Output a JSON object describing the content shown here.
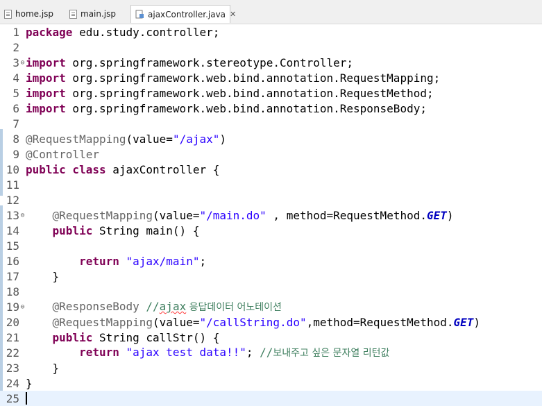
{
  "tabs": [
    {
      "label": "home.jsp",
      "active": false
    },
    {
      "label": "main.jsp",
      "active": false
    },
    {
      "label": "ajaxController.java",
      "active": true
    }
  ],
  "close_glyph": "✕",
  "fold_glyph": "⊖",
  "lines": [
    {
      "n": "1"
    },
    {
      "n": "2"
    },
    {
      "n": "3"
    },
    {
      "n": "4"
    },
    {
      "n": "5"
    },
    {
      "n": "6"
    },
    {
      "n": "7"
    },
    {
      "n": "8"
    },
    {
      "n": "9"
    },
    {
      "n": "10"
    },
    {
      "n": "11"
    },
    {
      "n": "12"
    },
    {
      "n": "13"
    },
    {
      "n": "14"
    },
    {
      "n": "15"
    },
    {
      "n": "16"
    },
    {
      "n": "17"
    },
    {
      "n": "18"
    },
    {
      "n": "19"
    },
    {
      "n": "20"
    },
    {
      "n": "21"
    },
    {
      "n": "22"
    },
    {
      "n": "23"
    },
    {
      "n": "24"
    },
    {
      "n": "25"
    }
  ],
  "code": {
    "l1": {
      "kw": "package",
      "rest": " edu.study.controller;"
    },
    "l3": {
      "kw": "import",
      "rest": " org.springframework.stereotype.Controller;"
    },
    "l4": {
      "kw": "import",
      "rest": " org.springframework.web.bind.annotation.RequestMapping;"
    },
    "l5": {
      "kw": "import",
      "rest": " org.springframework.web.bind.annotation.RequestMethod;"
    },
    "l6": {
      "kw": "import",
      "rest": " org.springframework.web.bind.annotation.ResponseBody;"
    },
    "l8": {
      "ann": "@RequestMapping",
      "p1": "(value=",
      "str": "\"/ajax\"",
      "p2": ")"
    },
    "l9": {
      "ann": "@Controller"
    },
    "l10": {
      "kw": "public class",
      "rest": " ajaxController {"
    },
    "l13": {
      "indent": "    ",
      "ann": "@RequestMapping",
      "p1": "(value=",
      "str": "\"/main.do\"",
      "p2": " , method=RequestMethod.",
      "fld": "GET",
      "p3": ")"
    },
    "l14": {
      "indent": "    ",
      "kw": "public",
      "rest": " String main() {"
    },
    "l16": {
      "indent": "        ",
      "kw": "return",
      "sp": " ",
      "str": "\"ajax/main\"",
      "p2": ";"
    },
    "l17": {
      "indent": "    ",
      "rest": "}"
    },
    "l19": {
      "indent": "    ",
      "ann": "@ResponseBody",
      "sp": " ",
      "cmt": "//",
      "cmt_word": "ajax",
      "cmt_kor": " 응답데이터 어노테이션"
    },
    "l20": {
      "indent": "    ",
      "ann": "@RequestMapping",
      "p1": "(value=",
      "str": "\"/callString.do\"",
      "p2": ",method=RequestMethod.",
      "fld": "GET",
      "p3": ")"
    },
    "l21": {
      "indent": "    ",
      "kw": "public",
      "rest": " String callStr() {"
    },
    "l22": {
      "indent": "        ",
      "kw": "return",
      "sp": " ",
      "str": "\"ajax test data!!\"",
      "p2": "; ",
      "cmt": "//",
      "cmt_kor": "보내주고 싶은 문자열 리턴값"
    },
    "l23": {
      "indent": "    ",
      "rest": "}"
    },
    "l24": {
      "rest": "}"
    }
  }
}
